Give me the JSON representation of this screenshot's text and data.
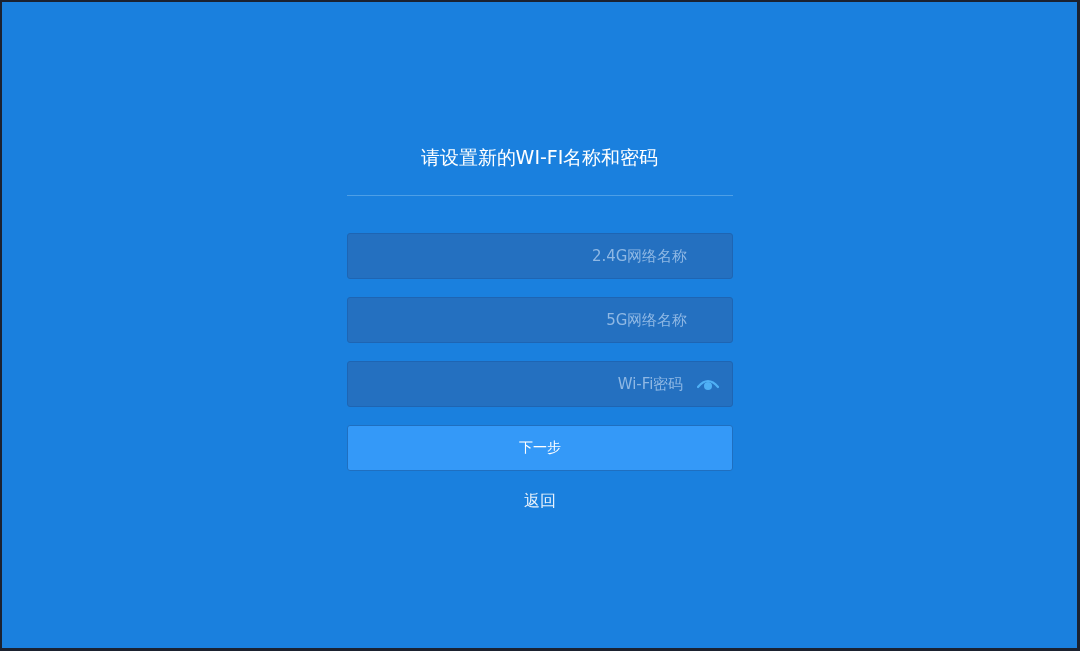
{
  "title": "请设置新的WI-FI名称和密码",
  "fields": [
    {
      "kind": "text",
      "placeholder": "2.4G网络名称"
    },
    {
      "kind": "text",
      "placeholder": "5G网络名称"
    },
    {
      "kind": "password",
      "placeholder": "Wi-Fi密码"
    }
  ],
  "next_button": "下一步",
  "back_link": "返回"
}
